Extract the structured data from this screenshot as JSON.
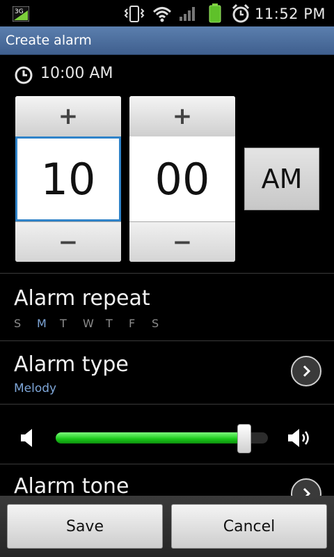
{
  "status_bar": {
    "network": "3G",
    "time": "11:52 PM",
    "icons": [
      "network-3g-icon",
      "vibrate-icon",
      "wifi-icon",
      "signal-icon",
      "battery-icon",
      "alarm-clock-icon"
    ]
  },
  "title_bar": {
    "title": "Create alarm"
  },
  "time_summary": {
    "text": "10:00 AM",
    "icon": "clock-icon"
  },
  "picker": {
    "hour": "10",
    "minute": "00",
    "ampm": "AM",
    "increment_label": "+",
    "decrement_label": "−"
  },
  "repeat": {
    "title": "Alarm repeat",
    "days": [
      "S",
      "M",
      "T",
      "W",
      "T",
      "F",
      "S"
    ],
    "active_day_index": 1
  },
  "alarm_type": {
    "title": "Alarm type",
    "value": "Melody"
  },
  "volume": {
    "level_fraction": 0.9,
    "colors": {
      "fill": "#19c819",
      "track": "#2c2c2c"
    }
  },
  "alarm_tone": {
    "title": "Alarm tone"
  },
  "buttons": {
    "save": "Save",
    "cancel": "Cancel"
  },
  "colors": {
    "title_bar": "#4a6c9e",
    "accent_blue": "#2f83c9",
    "sub_text": "#7ea6d8"
  }
}
